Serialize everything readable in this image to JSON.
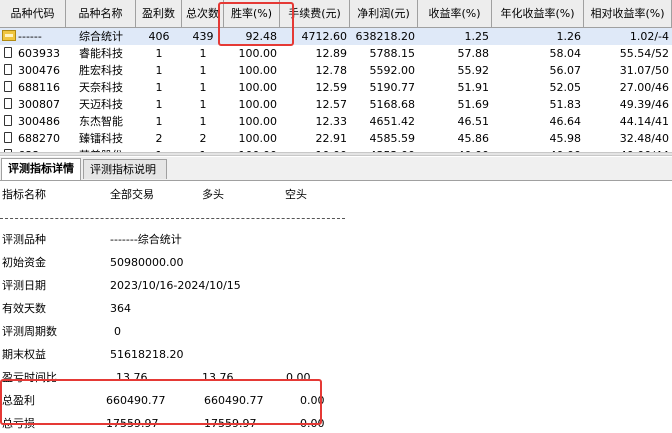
{
  "grid": {
    "headers": [
      "品种代码",
      "品种名称",
      "盈利数",
      "总次数",
      "胜率(%)",
      "手续费(元)",
      "净利润(元)",
      "收益率(%)",
      "年化收益率(%)",
      "相对收益率(%)"
    ],
    "rows": [
      [
        "------",
        "综合统计",
        "406",
        "439",
        "92.48",
        "4712.60",
        "638218.20",
        "1.25",
        "1.26",
        "1.02/-4"
      ],
      [
        "603933",
        "睿能科技",
        "1",
        "1",
        "100.00",
        "12.89",
        "5788.15",
        "57.88",
        "58.04",
        "55.54/52"
      ],
      [
        "300476",
        "胜宏科技",
        "1",
        "1",
        "100.00",
        "12.78",
        "5592.00",
        "55.92",
        "56.07",
        "31.07/50"
      ],
      [
        "688116",
        "天奈科技",
        "1",
        "1",
        "100.00",
        "12.59",
        "5190.77",
        "51.91",
        "52.05",
        "27.00/46"
      ],
      [
        "300807",
        "天迈科技",
        "1",
        "1",
        "100.00",
        "12.57",
        "5168.68",
        "51.69",
        "51.83",
        "49.39/46"
      ],
      [
        "300486",
        "东杰智能",
        "1",
        "1",
        "100.00",
        "12.33",
        "4651.42",
        "46.51",
        "46.64",
        "44.14/41"
      ],
      [
        "688270",
        "臻镭科技",
        "2",
        "2",
        "100.00",
        "22.91",
        "4585.59",
        "45.86",
        "45.98",
        "32.48/40"
      ],
      [
        "688______",
        "英普股份",
        "1",
        "1",
        "100.00",
        "10.00",
        "4352.00",
        "40.00",
        "40.00",
        "40.00/44"
      ]
    ]
  },
  "tabs": [
    "评测指标详情",
    "评测指标说明"
  ],
  "detail": {
    "header": {
      "label": "指标名称",
      "all": "全部交易",
      "long": "多头",
      "short": "空头"
    },
    "lines": [
      {
        "label": "评测品种",
        "v1": "-------综合统计",
        "v2": "",
        "v3": ""
      },
      {
        "label": "初始资金",
        "v1": "50980000.00",
        "v2": "",
        "v3": ""
      },
      {
        "label": "评测日期",
        "v1": "2023/10/16-2024/10/15",
        "v2": "",
        "v3": ""
      },
      {
        "label": "有效天数",
        "v1": "364",
        "v2": "",
        "v3": ""
      },
      {
        "label": "评测周期数",
        "v1": "0",
        "v2": "",
        "v3": ""
      },
      {
        "label": "期末权益",
        "v1": "51618218.20",
        "v2": "",
        "v3": ""
      },
      {
        "label": "盈亏时间比",
        "v1": "13.76",
        "v2": "13.76",
        "v3": "0.00"
      },
      {
        "label": "总盈利",
        "v1": "660490.77",
        "v2": "660490.77",
        "v3": "0.00"
      },
      {
        "label": "总亏损",
        "v1": "17559.97",
        "v2": "17559.97",
        "v3": "0.00"
      }
    ]
  },
  "colors": {
    "highlight": "#e53935",
    "header_bg": "#ededed",
    "selected_row": "#dfe9f8"
  }
}
